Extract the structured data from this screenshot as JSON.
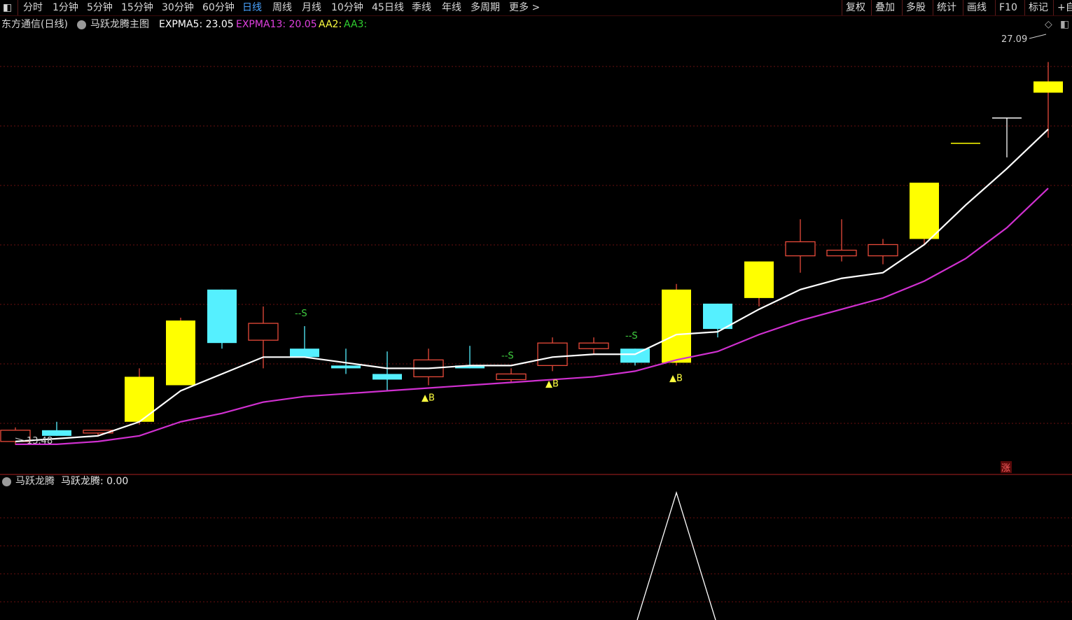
{
  "toolbar": {
    "periods": [
      "分时",
      "1分钟",
      "5分钟",
      "15分钟",
      "30分钟",
      "60分钟",
      "日线",
      "周线",
      "月线",
      "10分钟",
      "45日线",
      "季线",
      "年线",
      "多周期",
      "更多 >"
    ],
    "active_index": 6,
    "right_tools": [
      "复权",
      "叠加",
      "多股",
      "统计",
      "画线",
      "F10",
      "标记",
      "+自"
    ]
  },
  "main_panel": {
    "stock_title": "东方通信(日线)",
    "indicator_name": "马跃龙腾主图",
    "legend": [
      {
        "label": "EXPMA5: 23.05",
        "color": "#ffffff"
      },
      {
        "label": "EXPMA13: 20.05",
        "color": "#e040e0"
      },
      {
        "label": "AA2:",
        "color": "#ffff40"
      },
      {
        "label": "AA3:",
        "color": "#30d030"
      }
    ],
    "high_label": "27.09",
    "low_label": "13.48",
    "limit_up_badge": "涨",
    "buy_label": "▲B",
    "sell_label": "--S"
  },
  "sub_panel": {
    "indicator_name": "马跃龙腾",
    "value_label": "马跃龙腾: 0.00"
  },
  "colors": {
    "up_hollow": "#e84a3a",
    "up_big": "#ffff00",
    "down": "#55f0ff",
    "expma5": "#ffffff",
    "expma13": "#d030d0",
    "grid": "#6a1010",
    "buy": "#ffff40",
    "sell": "#40d040"
  },
  "chart_data": {
    "type": "candlestick",
    "price_range": [
      13.0,
      28.2
    ],
    "candles": [
      {
        "o": 14.0,
        "h": 14.1,
        "l": 13.48,
        "c": 13.6,
        "style": "hollow"
      },
      {
        "o": 14.0,
        "h": 14.3,
        "l": 13.8,
        "c": 13.8,
        "style": "down"
      },
      {
        "o": 13.9,
        "h": 14.0,
        "l": 13.8,
        "c": 14.0,
        "style": "hollow"
      },
      {
        "o": 14.3,
        "h": 16.2,
        "l": 14.2,
        "c": 15.9,
        "style": "big"
      },
      {
        "o": 15.6,
        "h": 18.0,
        "l": 15.6,
        "c": 17.9,
        "style": "big"
      },
      {
        "o": 19.0,
        "h": 19.0,
        "l": 16.9,
        "c": 17.1,
        "style": "down"
      },
      {
        "o": 17.2,
        "h": 18.4,
        "l": 16.2,
        "c": 17.8,
        "style": "hollow"
      },
      {
        "o": 16.9,
        "h": 17.7,
        "l": 16.6,
        "c": 16.6,
        "style": "down"
      },
      {
        "o": 16.3,
        "h": 16.9,
        "l": 16.0,
        "c": 16.2,
        "style": "down"
      },
      {
        "o": 16.0,
        "h": 16.8,
        "l": 15.4,
        "c": 15.8,
        "style": "down"
      },
      {
        "o": 15.9,
        "h": 16.9,
        "l": 15.6,
        "c": 16.5,
        "style": "hollow"
      },
      {
        "o": 16.3,
        "h": 17.0,
        "l": 16.2,
        "c": 16.2,
        "style": "down"
      },
      {
        "o": 15.8,
        "h": 16.2,
        "l": 15.7,
        "c": 16.0,
        "style": "hollow"
      },
      {
        "o": 16.3,
        "h": 17.3,
        "l": 16.1,
        "c": 17.1,
        "style": "hollow"
      },
      {
        "o": 16.9,
        "h": 17.3,
        "l": 16.7,
        "c": 17.1,
        "style": "hollow"
      },
      {
        "o": 16.9,
        "h": 16.9,
        "l": 16.3,
        "c": 16.4,
        "style": "down"
      },
      {
        "o": 16.4,
        "h": 19.2,
        "l": 16.3,
        "c": 19.0,
        "style": "big"
      },
      {
        "o": 18.5,
        "h": 18.5,
        "l": 17.3,
        "c": 17.6,
        "style": "down"
      },
      {
        "o": 18.7,
        "h": 20.0,
        "l": 18.4,
        "c": 20.0,
        "style": "big"
      },
      {
        "o": 20.2,
        "h": 21.5,
        "l": 19.6,
        "c": 20.7,
        "style": "hollow"
      },
      {
        "o": 20.2,
        "h": 21.5,
        "l": 20.0,
        "c": 20.4,
        "style": "hollow"
      },
      {
        "o": 20.2,
        "h": 20.8,
        "l": 19.9,
        "c": 20.6,
        "style": "hollow"
      },
      {
        "o": 20.8,
        "h": 22.8,
        "l": 20.6,
        "c": 22.8,
        "style": "big"
      },
      {
        "o": 24.2,
        "h": 24.2,
        "l": 24.2,
        "c": 24.2,
        "style": "flat"
      },
      {
        "o": 25.1,
        "h": 25.1,
        "l": 23.7,
        "c": 25.1,
        "style": "flat"
      },
      {
        "o": 26.0,
        "h": 27.09,
        "l": 24.4,
        "c": 26.4,
        "style": "big"
      }
    ],
    "expma5": [
      13.6,
      13.7,
      13.8,
      14.3,
      15.4,
      16.0,
      16.6,
      16.6,
      16.4,
      16.2,
      16.2,
      16.3,
      16.3,
      16.6,
      16.7,
      16.7,
      17.4,
      17.5,
      18.3,
      19.0,
      19.4,
      19.6,
      20.6,
      22.0,
      23.3,
      24.7
    ],
    "expma13": [
      13.5,
      13.5,
      13.6,
      13.8,
      14.3,
      14.6,
      15.0,
      15.2,
      15.3,
      15.4,
      15.5,
      15.6,
      15.7,
      15.8,
      15.9,
      16.1,
      16.5,
      16.8,
      17.4,
      17.9,
      18.3,
      18.7,
      19.3,
      20.1,
      21.2,
      22.6
    ],
    "signals": [
      {
        "i": 7,
        "type": "S"
      },
      {
        "i": 10,
        "type": "B"
      },
      {
        "i": 12,
        "type": "S"
      },
      {
        "i": 13,
        "type": "B"
      },
      {
        "i": 15,
        "type": "S"
      },
      {
        "i": 16,
        "type": "B"
      }
    ],
    "sub_series": [
      0,
      0,
      0,
      0,
      0,
      0,
      0,
      0,
      0,
      0,
      0,
      0,
      0,
      0,
      0,
      0,
      1,
      0,
      0,
      0,
      0,
      0,
      0,
      0,
      0,
      0
    ]
  }
}
